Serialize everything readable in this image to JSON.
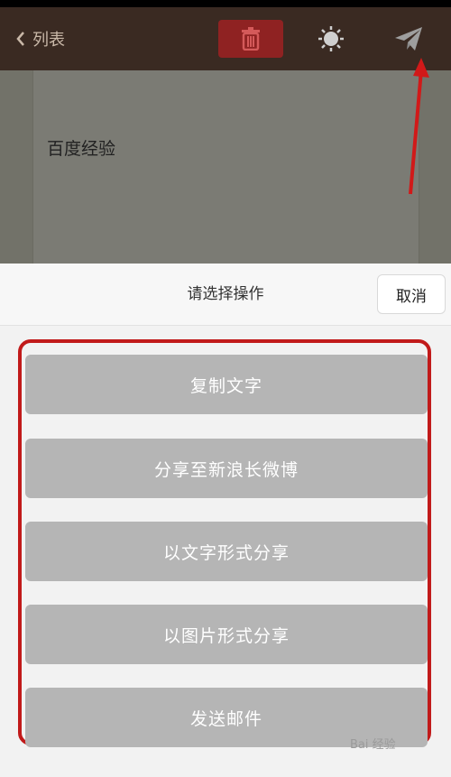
{
  "header": {
    "back_label": "列表",
    "colors": {
      "bar": "#3a2a22",
      "delete_button": "#8f2222",
      "icon": "#b8b8b8"
    }
  },
  "note": {
    "body_text": "百度经验"
  },
  "sheet": {
    "title": "请选择操作",
    "cancel_label": "取消",
    "actions": [
      {
        "label": "复制文字"
      },
      {
        "label": "分享至新浪长微博"
      },
      {
        "label": "以文字形式分享"
      },
      {
        "label": "以图片形式分享"
      },
      {
        "label": "发送邮件"
      }
    ],
    "colors": {
      "action_bg": "#b5b5b5",
      "highlight_border": "#c11a1a"
    }
  },
  "watermark": {
    "text": "Bai 经验"
  }
}
